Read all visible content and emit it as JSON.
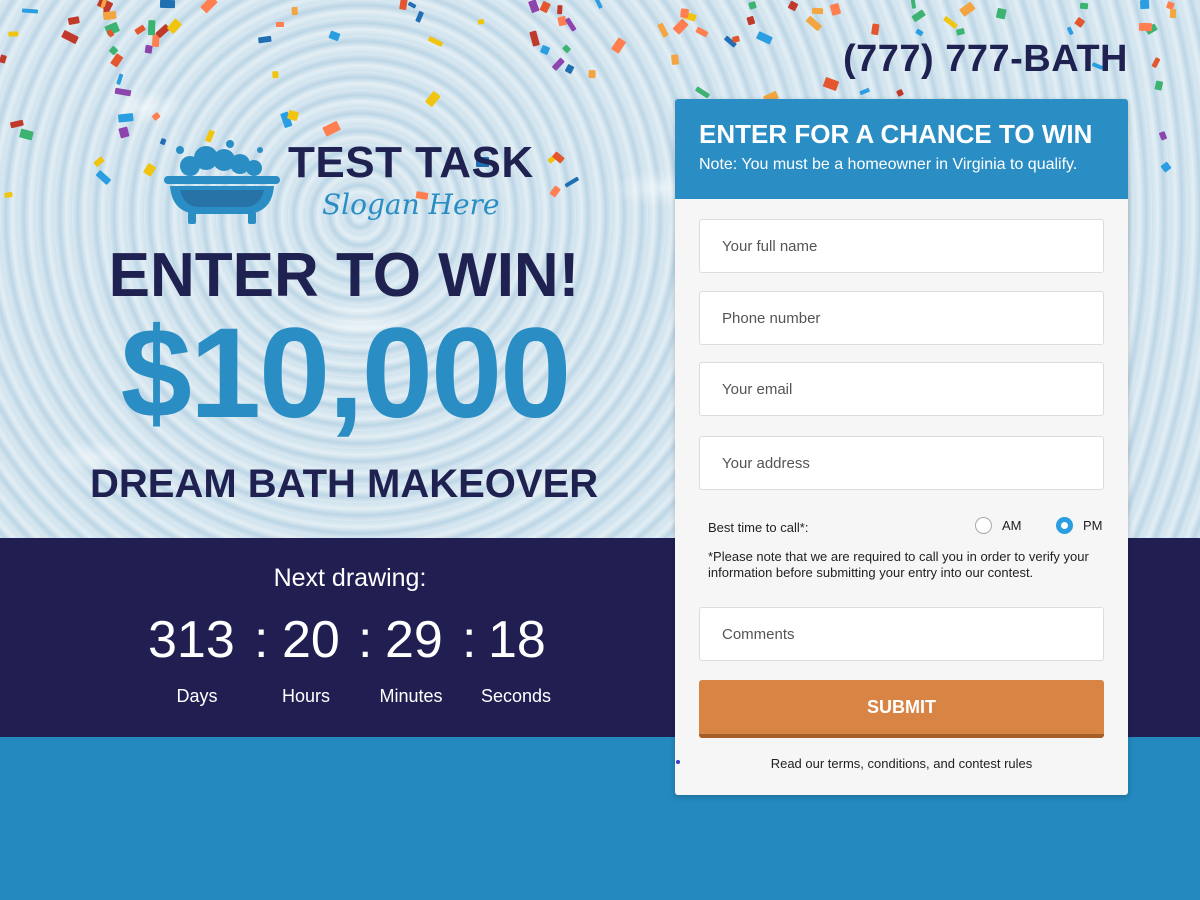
{
  "header": {
    "phone": "(777) 777-BATH"
  },
  "brand": {
    "name": "TEST TASK",
    "slogan": "Slogan Here",
    "logo_icon": "bathtub-icon"
  },
  "hero": {
    "headline": "ENTER TO WIN!",
    "amount": "$10,000",
    "subheadline": "DREAM BATH MAKEOVER"
  },
  "countdown": {
    "label": "Next drawing:",
    "days": "313",
    "hours": "20",
    "minutes": "29",
    "seconds": "18",
    "separator": ":",
    "unit_days": "Days",
    "unit_hours": "Hours",
    "unit_minutes": "Minutes",
    "unit_seconds": "Seconds"
  },
  "form": {
    "title": "ENTER FOR A CHANCE TO WIN",
    "note": "Note: You must be a homeowner in Virginia to qualify.",
    "name_placeholder": "Your full name",
    "phone_placeholder": "Phone number",
    "email_placeholder": "Your email",
    "address_placeholder": "Your address",
    "best_time_label": "Best time to call*:",
    "option_am": "AM",
    "option_pm": "PM",
    "selected_time": "PM",
    "notice": "*Please note that we are required to call you in order to verify your information before submitting your entry into our contest.",
    "comments_placeholder": "Comments",
    "submit_label": "SUBMIT",
    "terms_link": "Read our terms, conditions, and contest rules"
  },
  "colors": {
    "navy": "#1f2150",
    "brand_blue": "#2a8ec4",
    "submit_orange": "#d78445",
    "countdown_bg": "#211f52",
    "footer_blue": "#2389be"
  }
}
